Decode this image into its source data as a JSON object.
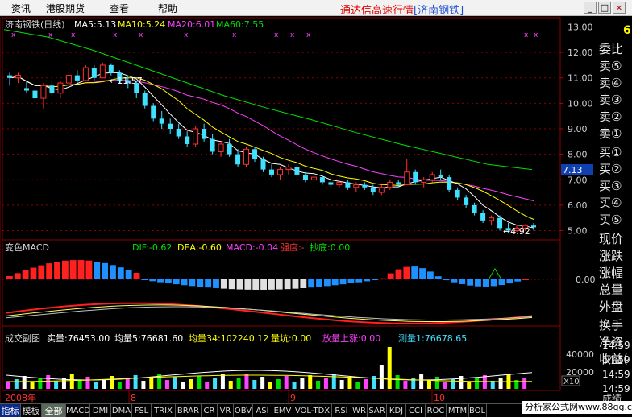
{
  "menu": [
    "资讯",
    "港股期货",
    "查看",
    "帮助"
  ],
  "title": {
    "prefix": "通达信高速行情",
    "symbol": "[济南钢铁]"
  },
  "window_buttons": [
    "_",
    "□",
    "×"
  ],
  "price_panel": {
    "name": "济南钢铁(日线)",
    "ma": [
      {
        "label": "MA5:5.13",
        "color": "#ffffff"
      },
      {
        "label": "MA10:5.24",
        "color": "#ffff00"
      },
      {
        "label": "MA20:6.01",
        "color": "#ff40ff"
      },
      {
        "label": "MA60:7.55",
        "color": "#00e000"
      }
    ],
    "y_ticks": [
      "13.00",
      "12.00",
      "11.00",
      "10.00",
      "9.00",
      "8.00",
      "7.00",
      "6.00",
      "5.00"
    ],
    "high_label": "11.57",
    "low_label": "4.92",
    "current_price": "7.13"
  },
  "macd_panel": {
    "title": "变色MACD",
    "dif": "DIF:-0.62",
    "dea": "DEA:-0.60",
    "macd": "MACD:-0.04",
    "strength": "强度:-",
    "bottom": "抄底:0.00",
    "zero_tick": "0.00"
  },
  "vol_panel": {
    "title": "成交副图",
    "real": "实量:76453.00",
    "avg5": "均量5:76681.60",
    "avg34": "均量34:102240.12",
    "pit": "量坑:0.00",
    "rise": "放量上涨:0.00",
    "measure": "测量1:76678.65",
    "y_ticks": [
      "40000",
      "20000"
    ],
    "unit": "X10"
  },
  "date_axis": [
    "2008年",
    "8",
    "9",
    "10"
  ],
  "right_panel": {
    "labels": [
      "委比",
      "卖⑤",
      "卖④",
      "卖③",
      "卖②",
      "卖①",
      "买①",
      "买②",
      "买③",
      "买④",
      "买⑤",
      "现价",
      "涨跌",
      "涨幅",
      "总量",
      "外盘",
      "换手",
      "净资",
      "收益("
    ],
    "times": [
      "14:59",
      "14:59",
      "14:59",
      "14:59"
    ],
    "top_value": "6",
    "bottom_label": "成绩"
  },
  "tabs": [
    "指标",
    "模板",
    "全部",
    "MACD",
    "DMI",
    "DMA",
    "FSL",
    "TRIX",
    "BRAR",
    "CR",
    "VR",
    "OBV",
    "ASI",
    "EMV",
    "VOL-TDX",
    "RSI",
    "WR",
    "SAR",
    "KDJ",
    "CCI",
    "ROC",
    "MTM",
    "BOLL"
  ],
  "watermark": "分析家公式网www.88gg.com",
  "colors": {
    "up": "#ff3030",
    "down": "#40e0ff",
    "ma5": "#ffffff",
    "ma10": "#ffff00",
    "ma20": "#ff40ff",
    "ma60": "#00e000",
    "grid": "#8b0000"
  },
  "chart_data": {
    "type": "candlestick",
    "y_range": [
      4.7,
      13.3
    ],
    "ma60_values": [
      12.9,
      12.6,
      12.1,
      11.5,
      10.9,
      10.3,
      9.8,
      9.35,
      8.85,
      8.4,
      8.0,
      7.6,
      7.4
    ],
    "candles": [
      [
        11.1,
        11.2,
        10.7,
        11.0
      ],
      [
        11.0,
        11.2,
        10.8,
        11.1
      ],
      [
        10.6,
        10.9,
        10.4,
        10.5
      ],
      [
        10.5,
        10.6,
        10.0,
        10.2
      ],
      [
        10.2,
        10.8,
        9.8,
        10.7
      ],
      [
        10.7,
        10.9,
        10.3,
        10.4
      ],
      [
        10.4,
        10.9,
        10.2,
        10.8
      ],
      [
        10.8,
        11.2,
        10.6,
        11.1
      ],
      [
        11.1,
        11.3,
        10.8,
        10.9
      ],
      [
        10.9,
        11.5,
        10.9,
        11.4
      ],
      [
        11.4,
        11.5,
        10.9,
        11.0
      ],
      [
        11.0,
        11.6,
        11.0,
        11.5
      ],
      [
        11.5,
        11.57,
        11.1,
        11.2
      ],
      [
        11.2,
        11.3,
        10.8,
        10.9
      ],
      [
        10.9,
        11.1,
        10.6,
        10.8
      ],
      [
        10.8,
        10.9,
        10.2,
        10.4
      ],
      [
        10.4,
        10.5,
        9.8,
        9.9
      ],
      [
        9.9,
        10.0,
        9.3,
        9.4
      ],
      [
        9.4,
        9.7,
        9.0,
        9.2
      ],
      [
        9.2,
        9.4,
        8.8,
        9.0
      ],
      [
        9.0,
        9.2,
        8.6,
        8.7
      ],
      [
        8.7,
        8.9,
        8.3,
        8.4
      ],
      [
        8.4,
        9.1,
        8.3,
        9.0
      ],
      [
        9.0,
        9.2,
        8.5,
        8.6
      ],
      [
        8.6,
        8.8,
        8.0,
        8.1
      ],
      [
        8.1,
        8.5,
        7.9,
        8.4
      ],
      [
        8.4,
        8.6,
        7.9,
        8.0
      ],
      [
        8.0,
        8.2,
        7.5,
        7.6
      ],
      [
        7.6,
        8.3,
        7.5,
        8.2
      ],
      [
        8.2,
        8.3,
        7.7,
        7.8
      ],
      [
        7.8,
        7.9,
        7.3,
        7.4
      ],
      [
        7.4,
        7.6,
        7.1,
        7.2
      ],
      [
        7.2,
        7.5,
        7.0,
        7.4
      ],
      [
        7.4,
        7.6,
        7.2,
        7.5
      ],
      [
        7.5,
        7.6,
        7.1,
        7.2
      ],
      [
        7.2,
        7.3,
        6.9,
        7.0
      ],
      [
        7.0,
        7.2,
        6.9,
        7.1
      ],
      [
        7.1,
        7.2,
        6.8,
        6.9
      ],
      [
        6.9,
        7.1,
        6.7,
        6.8
      ],
      [
        6.8,
        7.0,
        6.7,
        6.9
      ],
      [
        6.9,
        7.0,
        6.6,
        6.7
      ],
      [
        6.7,
        6.9,
        6.5,
        6.8
      ],
      [
        6.8,
        6.9,
        6.6,
        6.7
      ],
      [
        6.7,
        6.8,
        6.4,
        6.5
      ],
      [
        6.5,
        6.8,
        6.4,
        6.7
      ],
      [
        6.7,
        7.0,
        6.6,
        6.9
      ],
      [
        6.9,
        7.0,
        6.7,
        6.8
      ],
      [
        6.8,
        7.8,
        6.8,
        7.3
      ],
      [
        7.3,
        7.4,
        6.8,
        6.9
      ],
      [
        6.9,
        7.1,
        6.7,
        7.0
      ],
      [
        7.0,
        7.3,
        6.9,
        7.2
      ],
      [
        7.2,
        7.4,
        7.0,
        7.1
      ],
      [
        7.1,
        7.2,
        6.5,
        6.6
      ],
      [
        6.6,
        6.7,
        6.2,
        6.3
      ],
      [
        6.3,
        6.4,
        5.9,
        6.0
      ],
      [
        6.0,
        6.1,
        5.6,
        5.7
      ],
      [
        5.7,
        5.8,
        5.3,
        5.4
      ],
      [
        5.4,
        5.6,
        5.2,
        5.5
      ],
      [
        5.5,
        5.6,
        5.0,
        5.1
      ],
      [
        5.1,
        5.3,
        4.92,
        5.0
      ],
      [
        5.0,
        5.2,
        4.95,
        5.1
      ],
      [
        5.1,
        5.25,
        5.0,
        5.2
      ],
      [
        5.2,
        5.3,
        5.0,
        5.13
      ]
    ]
  }
}
